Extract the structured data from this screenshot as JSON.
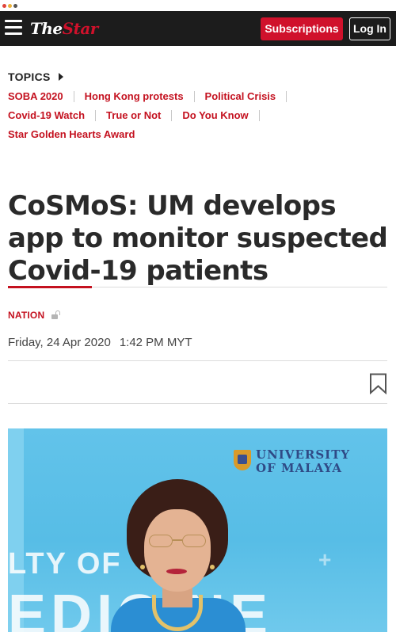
{
  "header": {
    "logo_part1": "The",
    "logo_part2": "Star",
    "subscriptions_label": "Subscriptions",
    "login_label": "Log In",
    "brand_color": "#d0112b"
  },
  "topics": {
    "heading": "TOPICS",
    "items": [
      "SOBA 2020",
      "Hong Kong protests",
      "Political Crisis",
      "Covid-19 Watch",
      "True or Not",
      "Do You Know",
      "Star Golden Hearts Award"
    ]
  },
  "article": {
    "headline": "CoSMoS: UM develops app to monitor suspected Covid-19 patients",
    "section": "NATION",
    "date": "Friday, 24 Apr 2020",
    "time": "1:42 PM MYT",
    "accent_color": "#c4111f"
  },
  "photo": {
    "sign_line1": "UNIVERSITY",
    "sign_line2": "OF MALAYA",
    "wall_line1": "LTY OF",
    "wall_line2": "EDICINE"
  },
  "icons": {
    "menu": "hamburger-menu-icon",
    "topics_caret": "caret-right-icon",
    "lock": "lock-icon",
    "bookmark": "bookmark-icon"
  }
}
